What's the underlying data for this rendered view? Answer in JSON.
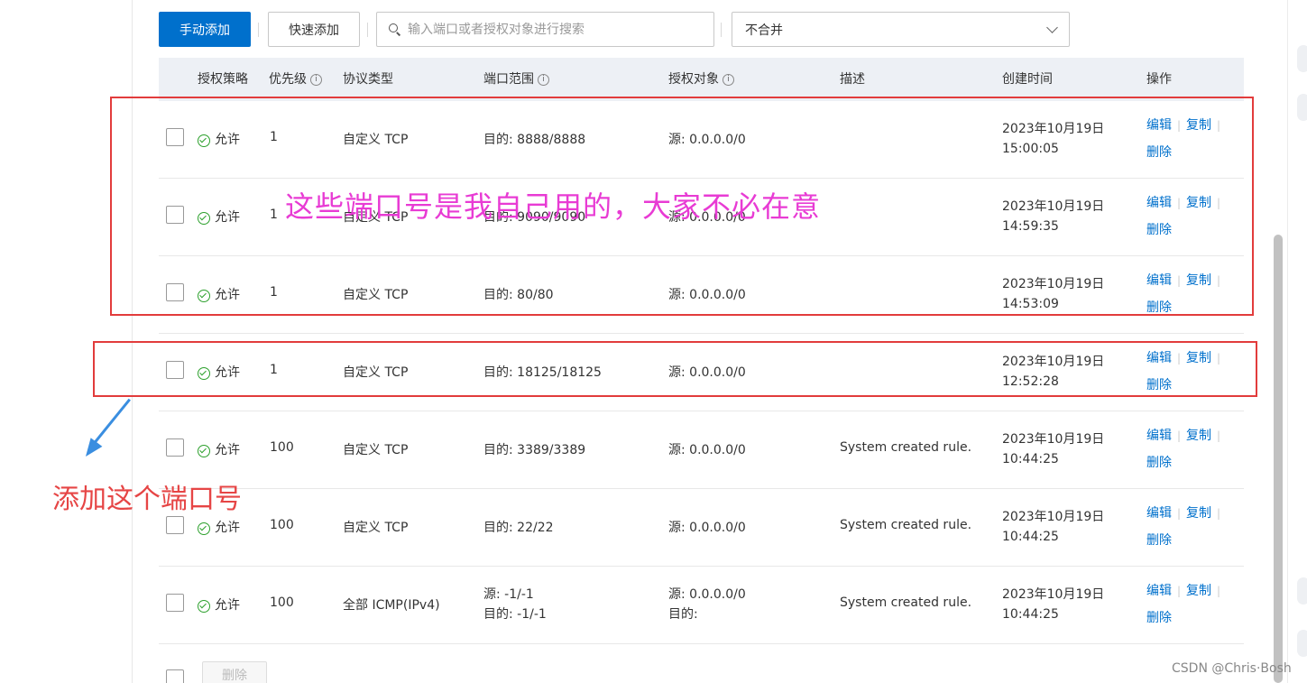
{
  "toolbar": {
    "manual_add": "手动添加",
    "quick_add": "快速添加",
    "search_placeholder": "输入端口或者授权对象进行搜索",
    "merge_select": "不合并"
  },
  "table": {
    "headers": {
      "policy": "授权策略",
      "priority": "优先级",
      "protocol": "协议类型",
      "port_range": "端口范围",
      "auth_object": "授权对象",
      "description": "描述",
      "created": "创建时间",
      "actions": "操作"
    },
    "actions": {
      "edit": "编辑",
      "copy": "复制",
      "delete": "删除"
    },
    "rows": [
      {
        "policy": "允许",
        "priority": "1",
        "protocol": "自定义 TCP",
        "port": "目的: 8888/8888",
        "port2": "",
        "auth": "源: 0.0.0.0/0",
        "auth2": "",
        "desc": "",
        "date": "2023年10月19日",
        "time": "15:00:05"
      },
      {
        "policy": "允许",
        "priority": "1",
        "protocol": "自定义 TCP",
        "port": "目的: 9090/9090",
        "port2": "",
        "auth": "源: 0.0.0.0/0",
        "auth2": "",
        "desc": "",
        "date": "2023年10月19日",
        "time": "14:59:35"
      },
      {
        "policy": "允许",
        "priority": "1",
        "protocol": "自定义 TCP",
        "port": "目的: 80/80",
        "port2": "",
        "auth": "源: 0.0.0.0/0",
        "auth2": "",
        "desc": "",
        "date": "2023年10月19日",
        "time": "14:53:09"
      },
      {
        "policy": "允许",
        "priority": "1",
        "protocol": "自定义 TCP",
        "port": "目的: 18125/18125",
        "port2": "",
        "auth": "源: 0.0.0.0/0",
        "auth2": "",
        "desc": "",
        "date": "2023年10月19日",
        "time": "12:52:28"
      },
      {
        "policy": "允许",
        "priority": "100",
        "protocol": "自定义 TCP",
        "port": "目的: 3389/3389",
        "port2": "",
        "auth": "源: 0.0.0.0/0",
        "auth2": "",
        "desc": "System created rule.",
        "date": "2023年10月19日",
        "time": "10:44:25"
      },
      {
        "policy": "允许",
        "priority": "100",
        "protocol": "自定义 TCP",
        "port": "目的: 22/22",
        "port2": "",
        "auth": "源: 0.0.0.0/0",
        "auth2": "",
        "desc": "System created rule.",
        "date": "2023年10月19日",
        "time": "10:44:25"
      },
      {
        "policy": "允许",
        "priority": "100",
        "protocol": "全部 ICMP(IPv4)",
        "port": "源: -1/-1",
        "port2": "目的: -1/-1",
        "auth": "源: 0.0.0.0/0",
        "auth2": "目的:",
        "desc": "System created rule.",
        "date": "2023年10月19日",
        "time": "10:44:25"
      }
    ]
  },
  "footer": {
    "delete": "删除"
  },
  "annotations": {
    "own_ports": "这些端口号是我自己用的，大家不必在意",
    "add_this": "添加这个端口号"
  },
  "watermark": "CSDN @Chris·Bosh",
  "colors": {
    "primary": "#0070cc",
    "allow": "#2ca02c",
    "annotation_pink": "#e83bd4",
    "annotation_red": "#e64545",
    "box_red": "#e23c3c",
    "arrow_blue": "#3a8ee0"
  }
}
